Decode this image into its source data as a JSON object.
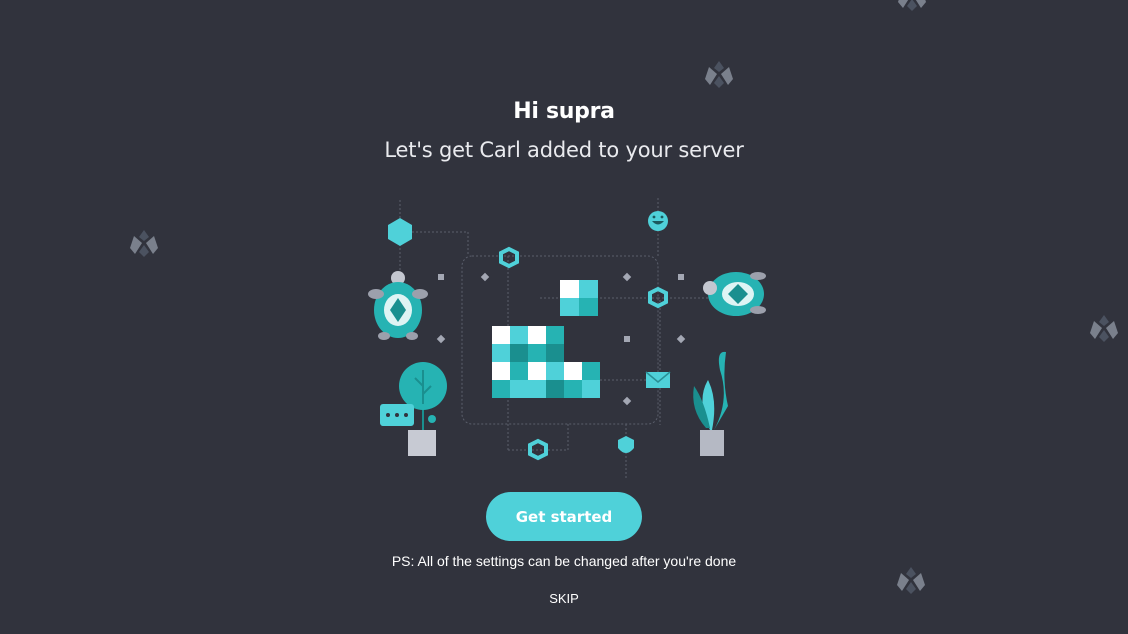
{
  "greeting": "Hi supra",
  "subtitle": "Let's get Carl added to your server",
  "cta_label": "Get started",
  "note": "PS: All of the settings can be changed after you're done",
  "skip_label": "SKIP",
  "colors": {
    "background": "#31333d",
    "accent": "#4fd1d9",
    "teal": "#26b3b3",
    "dark_teal": "#1a8f8f",
    "logo_gray": "#6b7280"
  },
  "icons": {
    "background_logo": "carl-logo-icon",
    "illustration": "onboarding-illustration"
  }
}
